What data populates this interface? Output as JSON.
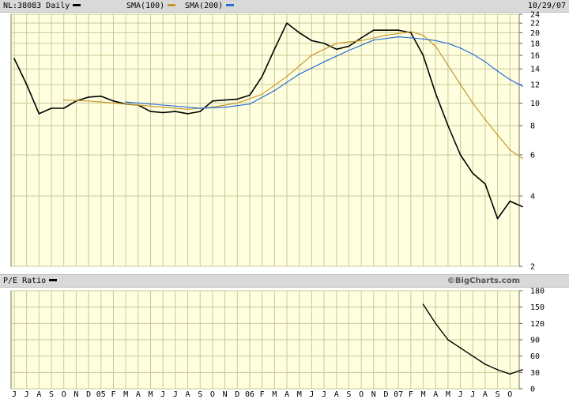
{
  "header": {
    "ticker_label": "NL:38083 Daily",
    "sma100_label": "SMA(100)",
    "sma200_label": "SMA(200)",
    "date": "10/29/07"
  },
  "pe_panel": {
    "label": "P/E Ratio",
    "watermark": "©BigCharts.com"
  },
  "colors": {
    "price": "#000000",
    "sma100": "#c8962e",
    "sma200": "#2a6fd6",
    "plot_bg": "#ffffe0",
    "grid": "#c8c896"
  },
  "chart_data": [
    {
      "type": "line",
      "scale": "log",
      "ylim": [
        2,
        24
      ],
      "y_ticks": [
        2,
        4,
        6,
        8,
        10,
        12,
        14,
        16,
        18,
        20,
        22,
        24
      ],
      "x_tick_labels": [
        "J",
        "J",
        "A",
        "S",
        "O",
        "N",
        "D",
        "05",
        "F",
        "M",
        "A",
        "M",
        "J",
        "J",
        "A",
        "S",
        "O",
        "N",
        "D",
        "06",
        "F",
        "M",
        "A",
        "M",
        "J",
        "J",
        "A",
        "S",
        "O",
        "N",
        "D",
        "07",
        "F",
        "M",
        "A",
        "M",
        "J",
        "J",
        "A",
        "S",
        "O"
      ],
      "grid": true,
      "series": [
        {
          "name": "NL:38083 Daily",
          "role": "price",
          "x": [
            0,
            1,
            2,
            3,
            4,
            5,
            6,
            7,
            8,
            9,
            10,
            11,
            12,
            13,
            14,
            15,
            16,
            17,
            18,
            19,
            20,
            21,
            22,
            23,
            24,
            25,
            26,
            27,
            28,
            29,
            30,
            31,
            32,
            33,
            34,
            35,
            36,
            37,
            38,
            39,
            40,
            41
          ],
          "values": [
            15.5,
            12,
            9,
            9.5,
            9.5,
            10.2,
            10.6,
            10.7,
            10.2,
            9.9,
            9.8,
            9.2,
            9.1,
            9.2,
            9.0,
            9.2,
            10.2,
            10.3,
            10.4,
            10.8,
            13,
            17,
            22,
            20,
            18.5,
            18,
            17,
            17.5,
            19,
            20.5,
            20.5,
            20.5,
            20,
            16,
            11,
            8,
            6,
            5,
            4.5,
            3.2,
            3.8,
            3.6
          ]
        },
        {
          "name": "SMA(100)",
          "role": "sma100",
          "x": [
            4,
            6,
            8,
            10,
            12,
            14,
            16,
            18,
            20,
            22,
            24,
            26,
            28,
            30,
            32,
            33,
            34,
            35,
            36,
            37,
            38,
            39,
            40,
            41
          ],
          "values": [
            10.3,
            10.2,
            10.0,
            9.8,
            9.6,
            9.4,
            9.6,
            10.0,
            10.9,
            13,
            16,
            18,
            18.5,
            19.5,
            20.2,
            19.5,
            17.5,
            14.5,
            12,
            10,
            8.5,
            7.3,
            6.3,
            5.8
          ]
        },
        {
          "name": "SMA(200)",
          "role": "sma200",
          "x": [
            9,
            11,
            13,
            15,
            17,
            19,
            21,
            23,
            25,
            27,
            29,
            31,
            33,
            34,
            35,
            36,
            37,
            38,
            39,
            40,
            41
          ],
          "values": [
            10.1,
            9.9,
            9.7,
            9.5,
            9.6,
            9.9,
            11.3,
            13.3,
            15,
            16.8,
            18.6,
            19.2,
            18.8,
            18.5,
            18,
            17.2,
            16.2,
            15,
            13.7,
            12.6,
            11.8
          ]
        }
      ]
    },
    {
      "type": "line",
      "title": "P/E Ratio",
      "ylim": [
        0,
        180
      ],
      "y_ticks": [
        0,
        30,
        60,
        90,
        120,
        150,
        180
      ],
      "grid": true,
      "series": [
        {
          "name": "P/E Ratio",
          "role": "pe",
          "x": [
            33,
            34,
            35,
            36,
            37,
            38,
            39,
            40,
            41
          ],
          "values": [
            155,
            120,
            90,
            75,
            60,
            45,
            35,
            27,
            35
          ]
        }
      ]
    }
  ]
}
